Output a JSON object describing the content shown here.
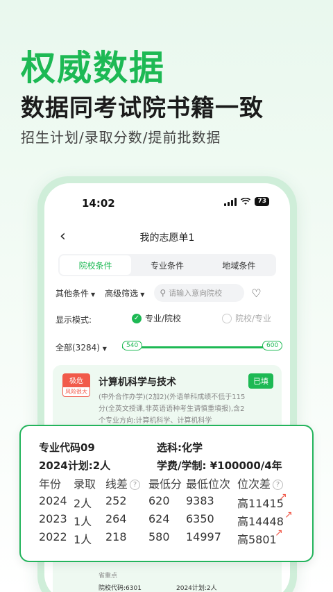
{
  "hero": {
    "headline": "权威数据",
    "subheadline": "数据同考试院书籍一致",
    "tagline": "招生计划/录取分数/提前批数据"
  },
  "status": {
    "time": "14:02",
    "battery": "73"
  },
  "nav": {
    "back_icon": "chevron-left-icon",
    "title": "我的志愿单1"
  },
  "tabs": [
    {
      "label": "院校条件",
      "active": true
    },
    {
      "label": "专业条件",
      "active": false
    },
    {
      "label": "地域条件",
      "active": false
    }
  ],
  "filters": {
    "other": "其他条件",
    "advanced": "高级筛选",
    "search_placeholder": "请输入意向院校"
  },
  "mode": {
    "label": "显示模式:",
    "option1": "专业/院校",
    "option2": "院校/专业"
  },
  "range": {
    "all": "全部(3284)",
    "min": "540",
    "max": "600"
  },
  "card": {
    "risk_top": "极危",
    "risk_bottom": "风险很大",
    "major": "计算机科学与技术",
    "filled": "已填",
    "desc": "(中外合作办学)(2加2)(外语单科成绩不低于115分(全英文授课,非英语语种考生请慎重填报),含2个专业方向:计算机科学、计算机科学",
    "level": "省重点",
    "school_code": "院校代码:6301",
    "plan": "2024计划:2人"
  },
  "overlay": {
    "major_code": "专业代码09",
    "subject": "选科:化学",
    "plan": "2024计划:2人",
    "tuition": "学费/学制: ¥100000/4年",
    "headers": [
      "年份",
      "录取",
      "线差",
      "最低分",
      "最低位次",
      "位次差"
    ],
    "rows": [
      [
        "2024",
        "2人",
        "252",
        "620",
        "9383",
        "高11415"
      ],
      [
        "2023",
        "1人",
        "264",
        "624",
        "6350",
        "高14448"
      ],
      [
        "2022",
        "1人",
        "218",
        "580",
        "14997",
        "高5801"
      ]
    ]
  },
  "colors": {
    "accent": "#1db954",
    "danger": "#f15a4a"
  }
}
